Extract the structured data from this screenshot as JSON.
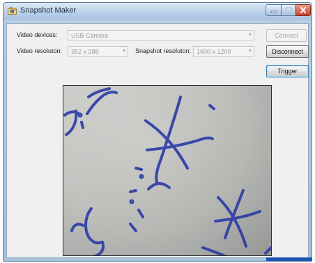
{
  "window": {
    "title": "Snapshot Maker"
  },
  "form": {
    "video_devices_label": "Video devices:",
    "video_devices_value": "USB Camera",
    "video_resolution_label": "Video resoluton:",
    "video_resolution_value": "352 x 288",
    "snapshot_resolution_label": "Snapshot resoluton:",
    "snapshot_resolution_value": "1600 x 1200"
  },
  "buttons": {
    "connect": "Connect",
    "disconnect": "Disconnect",
    "trigger": "Trigger"
  },
  "icons": {
    "app": "camera-app-icon",
    "minimize": "minimize-icon",
    "maximize": "maximize-icon",
    "close": "close-icon",
    "dropdown": "chevron-down-icon"
  },
  "colors": {
    "ink": "#2a3aa8",
    "close_button": "#c8442a",
    "title_bar": "#bcd2ea"
  }
}
